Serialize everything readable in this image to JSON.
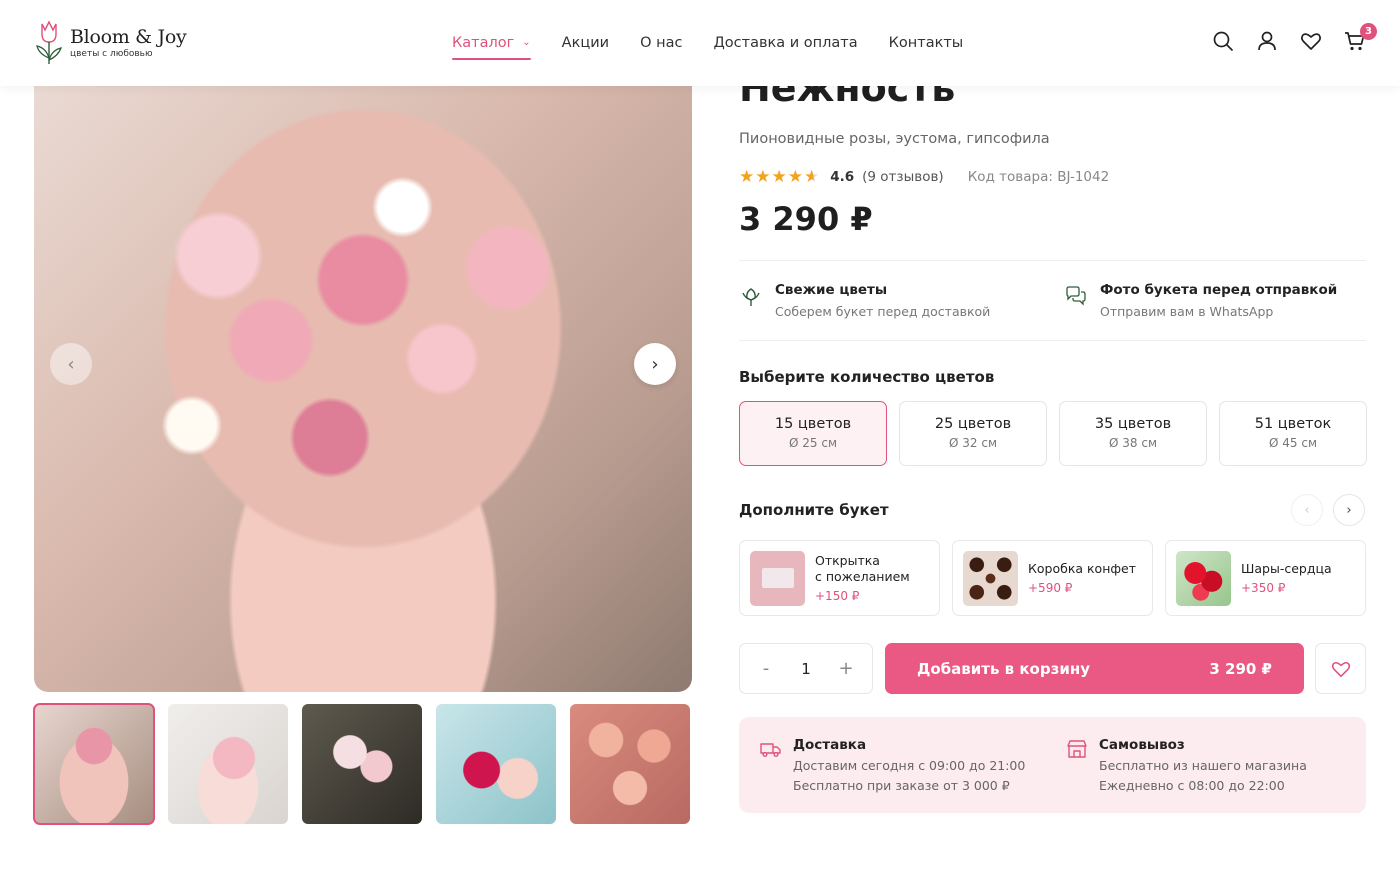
{
  "brand": {
    "name": "Bloom & Joy",
    "tagline": "цветы с любовью"
  },
  "nav": [
    {
      "label": "Каталог",
      "active": true
    },
    {
      "label": "Акции"
    },
    {
      "label": "О нас"
    },
    {
      "label": "Доставка и оплата"
    },
    {
      "label": "Контакты"
    }
  ],
  "header_icons": [
    "search-icon",
    "user-icon",
    "heart-icon",
    "cart-icon"
  ],
  "cart_count": "3",
  "product": {
    "title": "Нежность",
    "subtitle": "Пионовидные розы, эустома, гипсофила",
    "rating_value": 4.6,
    "rating_text": "4.6",
    "reviews": "(9 отзывов)",
    "sku": "Код товара: BJ-1042",
    "price": "3 290 ₽"
  },
  "gallery": {
    "thumbnail_count": 5,
    "active_index": 0
  },
  "features": [
    {
      "icon": "flower-icon",
      "title": "Свежие цветы",
      "text": "Соберем букет перед доставкой"
    },
    {
      "icon": "chat-icon",
      "title": "Фото букета перед отправкой",
      "text": "Отправим вам в WhatsApp"
    }
  ],
  "quantity_section": {
    "title": "Выберите количество цветов",
    "options": [
      {
        "count": "15 цветов",
        "diameter": "Ø 25 см",
        "selected": true
      },
      {
        "count": "25 цветов",
        "diameter": "Ø 32 см"
      },
      {
        "count": "35 цветов",
        "diameter": "Ø 38 см"
      },
      {
        "count": "51 цветок",
        "diameter": "Ø 45 см"
      }
    ]
  },
  "addons": {
    "title": "Дополните букет",
    "items": [
      {
        "name": "Открытка\nс пожеланием",
        "price": "+150 ₽"
      },
      {
        "name": "Коробка конфет",
        "price": "+590 ₽"
      },
      {
        "name": "Шары-сердца",
        "price": "+350 ₽"
      }
    ]
  },
  "purchase": {
    "minus": "-",
    "quantity": "1",
    "plus": "+",
    "add_to_cart": "Добавить в корзину",
    "cart_price": "3 290 ₽"
  },
  "delivery": {
    "delivery_title": "Доставка",
    "delivery_lines": [
      "Доставим сегодня с 09:00 до 21:00",
      "Бесплатно при заказе от 3 000 ₽"
    ],
    "pickup_title": "Самовывоз",
    "pickup_lines": [
      "Бесплатно из нашего магазина",
      "Ежедневно с 08:00 до 22:00"
    ]
  },
  "colors": {
    "accent": "#e0527c",
    "cart_button": "#ea5884",
    "delivery_bg": "#fcebef",
    "star": "#f3a31b"
  }
}
